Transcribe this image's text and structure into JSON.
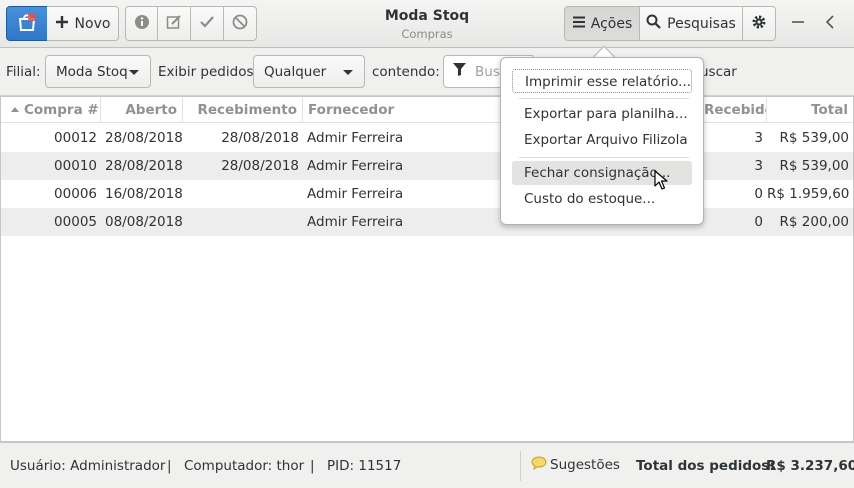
{
  "header": {
    "new_label": "Novo",
    "title": "Moda Stoq",
    "subtitle": "Compras",
    "actions_label": "Ações",
    "search_label": "Pesquisas",
    "app_icon": "shopping-bag-icon",
    "toolbar_icons": [
      "info-icon",
      "edit-icon",
      "check-icon",
      "cancel-icon"
    ]
  },
  "filter": {
    "branch_label": "Filial:",
    "branch_value": "Moda Stoq",
    "show_label": "Exibir pedidos",
    "show_value": "Qualquer",
    "contains_label": "contendo:",
    "search_placeholder": "Bus",
    "search_button_tail": "uscar"
  },
  "table": {
    "columns": {
      "number": "Compra #",
      "opened": "Aberto",
      "received_date": "Recebimento",
      "supplier": "Fornecedor",
      "received": "Recebido",
      "total": "Total"
    },
    "rows": [
      {
        "number": "00012",
        "opened": "28/08/2018",
        "received_date": "28/08/2018",
        "supplier": "Admir Ferreira",
        "received": "3",
        "total": "R$ 539,00"
      },
      {
        "number": "00010",
        "opened": "28/08/2018",
        "received_date": "28/08/2018",
        "supplier": "Admir Ferreira",
        "received": "3",
        "total": "R$ 539,00"
      },
      {
        "number": "00006",
        "opened": "16/08/2018",
        "received_date": "",
        "supplier": "Admir Ferreira",
        "received": "0",
        "total": "R$ 1.959,60"
      },
      {
        "number": "00005",
        "opened": "08/08/2018",
        "received_date": "",
        "supplier": "Admir Ferreira",
        "received": "0",
        "total": "R$ 200,00"
      }
    ]
  },
  "menu": {
    "items": [
      "Imprimir esse relatório...",
      "Exportar para planilha...",
      "Exportar Arquivo Filizola",
      "Fechar consignação...",
      "Custo do estoque..."
    ]
  },
  "status": {
    "user": "Usuário: Administrador",
    "sep": "|",
    "computer": "Computador: thor",
    "pid": "PID: 11517",
    "suggestions": "Sugestões",
    "total_label": "Total dos pedidos:",
    "total_value": "R$ 3.237,60"
  },
  "colors": {
    "accent": "#3584e4",
    "header_bg": "#ededec",
    "row_alt": "#ededed"
  }
}
